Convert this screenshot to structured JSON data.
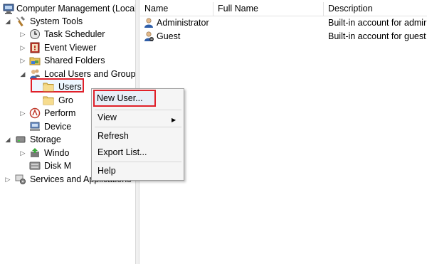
{
  "tree": {
    "items": [
      {
        "label": "Computer Management (Local",
        "icon": "computer-management-icon",
        "expander": ""
      },
      {
        "label": "System Tools",
        "icon": "system-tools-icon",
        "expander": "◢"
      },
      {
        "label": "Task Scheduler",
        "icon": "task-scheduler-icon",
        "expander": "▷"
      },
      {
        "label": "Event Viewer",
        "icon": "event-viewer-icon",
        "expander": "▷"
      },
      {
        "label": "Shared Folders",
        "icon": "shared-folders-icon",
        "expander": "▷"
      },
      {
        "label": "Local Users and Groups",
        "icon": "local-users-groups-icon",
        "expander": "◢"
      },
      {
        "label": "Users",
        "icon": "folder-icon",
        "expander": ""
      },
      {
        "label": "Gro",
        "icon": "folder-icon",
        "expander": ""
      },
      {
        "label": "Perform",
        "icon": "performance-icon",
        "expander": "▷"
      },
      {
        "label": "Device",
        "icon": "device-manager-icon",
        "expander": ""
      },
      {
        "label": "Storage",
        "icon": "storage-icon",
        "expander": "◢"
      },
      {
        "label": "Windo",
        "icon": "windows-server-backup-icon",
        "expander": "▷"
      },
      {
        "label": "Disk M",
        "icon": "disk-management-icon",
        "expander": ""
      },
      {
        "label": "Services and Applications",
        "icon": "services-applications-icon",
        "expander": "▷"
      }
    ]
  },
  "list": {
    "columns": [
      "Name",
      "Full Name",
      "Description"
    ],
    "rows": [
      {
        "name": "Administrator",
        "full_name": "",
        "description": "Built-in account for admir",
        "icon": "user-icon"
      },
      {
        "name": "Guest",
        "full_name": "",
        "description": "Built-in account for guest",
        "icon": "user-icon"
      }
    ]
  },
  "context_menu": {
    "items": {
      "new_user": "New User...",
      "view": "View",
      "refresh": "Refresh",
      "export_list": "Export List...",
      "help": "Help"
    },
    "submenu_arrow": "▶"
  },
  "colors": {
    "highlight_border": "#e0202a",
    "menu_background": "#f5f5f5"
  }
}
